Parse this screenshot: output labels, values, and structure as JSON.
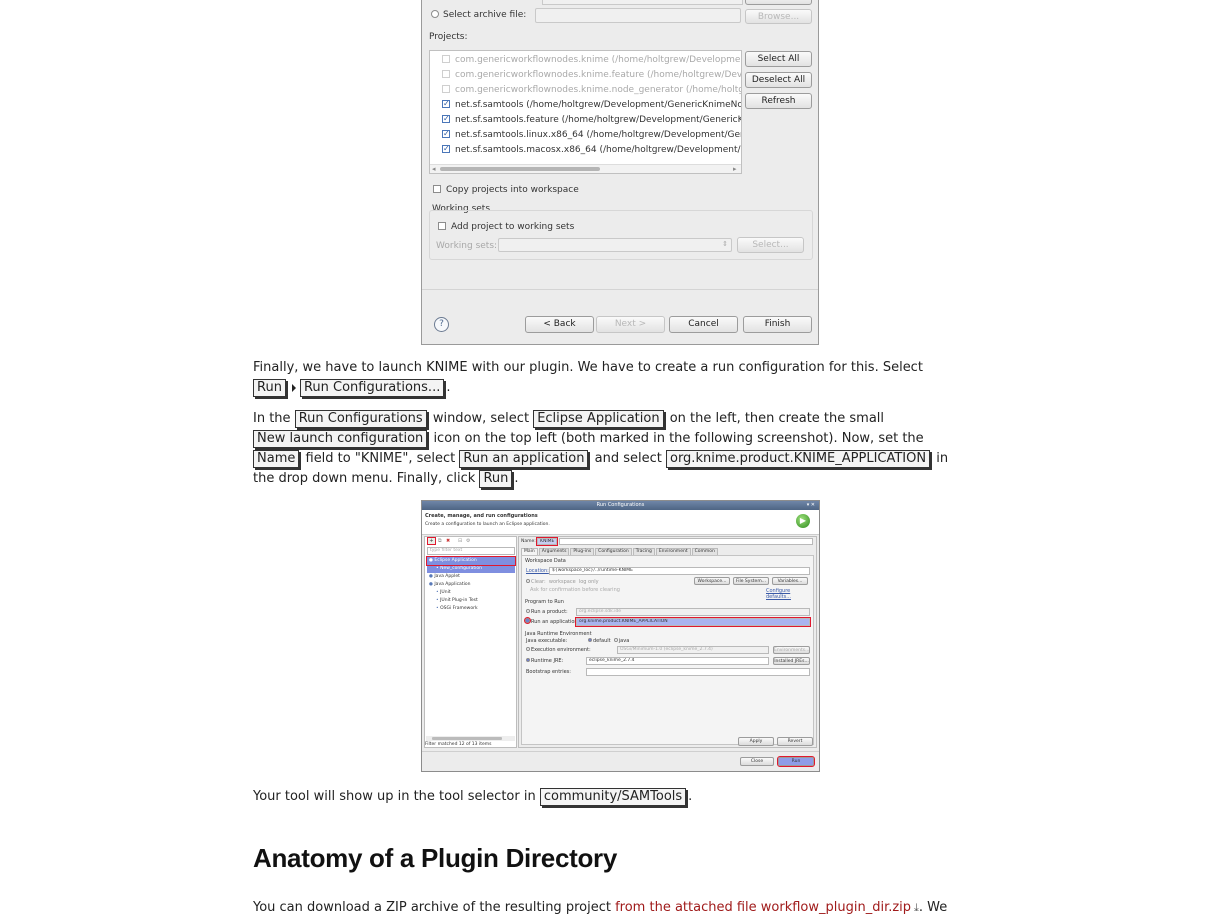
{
  "import_dialog": {
    "select_archive_label": "Select archive file:",
    "browse_label": "Browse...",
    "projects_label": "Projects:",
    "projects": [
      {
        "name": "com.genericworkflownodes.knime (/home/holtgrew/Development/G",
        "checked": false,
        "enabled": false
      },
      {
        "name": "com.genericworkflownodes.knime.feature (/home/holtgrew/Develo",
        "checked": false,
        "enabled": false
      },
      {
        "name": "com.genericworkflownodes.knime.node_generator (/home/holtgrev",
        "checked": false,
        "enabled": false
      },
      {
        "name": "net.sf.samtools (/home/holtgrew/Development/GenericKnimeNodes",
        "checked": true,
        "enabled": true
      },
      {
        "name": "net.sf.samtools.feature (/home/holtgrew/Development/GenericKnin",
        "checked": true,
        "enabled": true
      },
      {
        "name": "net.sf.samtools.linux.x86_64 (/home/holtgrew/Development/Generi",
        "checked": true,
        "enabled": true
      },
      {
        "name": "net.sf.samtools.macosx.x86_64 (/home/holtgrew/Development/Ger",
        "checked": true,
        "enabled": true
      }
    ],
    "select_all_label": "Select All",
    "deselect_all_label": "Deselect All",
    "refresh_label": "Refresh",
    "copy_projects_label": "Copy projects into workspace",
    "working_sets_label": "Working sets",
    "add_to_working_sets_label": "Add project to working sets",
    "working_sets_field_label": "Working sets:",
    "select_label": "Select...",
    "back_label": "< Back",
    "next_label": "Next >",
    "cancel_label": "Cancel",
    "finish_label": "Finish",
    "help_glyph": "?"
  },
  "doc": {
    "p1_text": "Finally, we have to launch KNIME with our plugin. We have to create a run configuration for this. Select",
    "p1_menu_run": "Run",
    "p1_menu_runcfg": "Run Configurations...",
    "p2_a": "In the",
    "p2_k1": "Run Configurations",
    "p2_b": "window, select",
    "p2_k2": "Eclipse Application",
    "p2_c": "on the left, then create the small",
    "p2_k3": "New launch configuration",
    "p2_d": "icon on the top left (both marked in the following screenshot). Now, set the",
    "p2_k4": "Name",
    "p2_e": "field to \"KNIME\", select",
    "p2_k5": "Run an application",
    "p2_f": "and select",
    "p2_k6": "org.knime.product.KNIME_APPLICATION",
    "p2_g": "in",
    "p2_h": "the drop down menu. Finally, click",
    "p2_k7": "Run",
    "p3_a": "Your tool will show up in the tool selector in",
    "p3_k1": "community/SAMTools",
    "heading": "Anatomy of a Plugin Directory",
    "p4_a": "You can download a ZIP archive of the resulting project",
    "p4_link": "from the attached file workflow_plugin_dir.zip",
    "p4_b": ". We"
  },
  "run_config": {
    "window_title": "Run Configurations",
    "header_title": "Create, manage, and run configurations",
    "header_subtitle": "Create a configuration to launch an Eclipse application.",
    "filter_placeholder": "type filter text",
    "tree": [
      {
        "label": "Eclipse Application",
        "level": 0,
        "selected": true
      },
      {
        "label": "New_configuration",
        "level": 1,
        "selected": true
      },
      {
        "label": "Java Applet",
        "level": 0,
        "selected": false
      },
      {
        "label": "Java Application",
        "level": 0,
        "selected": false
      },
      {
        "label": "JUnit",
        "level": 1,
        "selected": false
      },
      {
        "label": "JUnit Plug-in Test",
        "level": 1,
        "selected": false
      },
      {
        "label": "OSGi Framework",
        "level": 1,
        "selected": false
      }
    ],
    "filter_status": "Filter matched 12 of 13 items",
    "name_label": "Name:",
    "name_value": "KNIME",
    "tabs": [
      "Main",
      "Arguments",
      "Plug-ins",
      "Configuration",
      "Tracing",
      "Environment",
      "Common"
    ],
    "workspace_data_label": "Workspace Data",
    "location_label": "Location:",
    "location_value": "${workspace_loc}/../runtime-KNIME",
    "clear_label": "Clear:",
    "workspace_opt": "workspace",
    "log_only_opt": "log only",
    "ask_confirm_label": "Ask for confirmation before clearing",
    "workspace_btn": "Workspace...",
    "filesystem_btn": "File System...",
    "variables_btn": "Variables...",
    "configure_defaults": "Configure defaults...",
    "program_to_run_label": "Program to Run",
    "run_product_label": "Run a product:",
    "run_product_value": "org.eclipse.sdk.ide",
    "run_application_label": "Run an application:",
    "run_application_value": "org.knime.product.KNIME_APPLICATION",
    "jre_label": "Java Runtime Environment",
    "java_exec_label": "Java executable:",
    "default_opt": "default",
    "java_opt": "java",
    "exec_env_label": "Execution environment:",
    "exec_env_value": "OSGi/Minimum-1.0 (eclipse_knime_2.7.4)",
    "environments_btn": "Environments...",
    "runtime_jre_label": "Runtime JRE:",
    "runtime_jre_value": "eclipse_knime_2.7.4",
    "installed_jres_btn": "Installed JREs...",
    "bootstrap_label": "Bootstrap entries:",
    "apply_btn": "Apply",
    "revert_btn": "Revert",
    "close_btn": "Close",
    "run_btn": "Run"
  }
}
